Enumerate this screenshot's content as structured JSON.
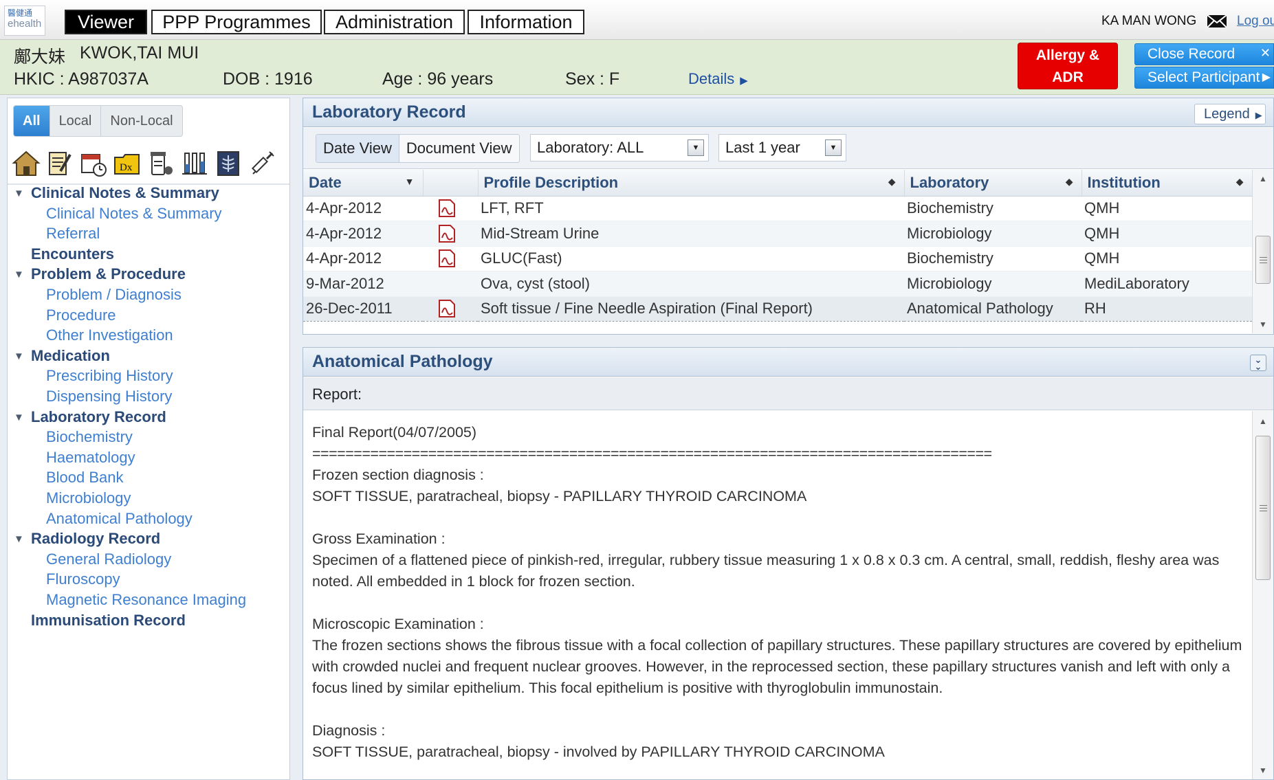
{
  "logo": {
    "line1": "醫健通",
    "line2": "ehealth"
  },
  "nav": {
    "tabs": [
      {
        "label": "Viewer",
        "active": true
      },
      {
        "label": "PPP Programmes",
        "active": false
      },
      {
        "label": "Administration",
        "active": false
      },
      {
        "label": "Information",
        "active": false
      }
    ],
    "user": "KA MAN WONG",
    "logout": "Log out"
  },
  "patient": {
    "chinese_name": "鄺大妹",
    "english_name": "KWOK,TAI MUI",
    "hkic": "HKIC : A987037A",
    "dob": "DOB : 1916",
    "age": "Age : 96 years",
    "sex": "Sex : F",
    "details_link": "Details"
  },
  "actions": {
    "allergy_line1": "Allergy &",
    "allergy_line2": "ADR",
    "close_record": "Close Record",
    "select_participant": "Select Participant"
  },
  "sidebar": {
    "scope": [
      {
        "label": "All",
        "active": true
      },
      {
        "label": "Local",
        "active": false
      },
      {
        "label": "Non-Local",
        "active": false
      }
    ],
    "tools": [
      "home-icon",
      "notes-icon",
      "calendar-icon",
      "diagnosis-icon",
      "medication-icon",
      "lab-tubes-icon",
      "radiology-icon",
      "syringe-icon"
    ],
    "tree": [
      {
        "label": "Clinical Notes & Summary",
        "type": "head",
        "expanded": true
      },
      {
        "label": "Clinical Notes & Summary",
        "type": "child"
      },
      {
        "label": "Referral",
        "type": "child"
      },
      {
        "label": "Encounters",
        "type": "head",
        "expanded": null
      },
      {
        "label": "Problem & Procedure",
        "type": "head",
        "expanded": true
      },
      {
        "label": "Problem / Diagnosis",
        "type": "child"
      },
      {
        "label": "Procedure",
        "type": "child"
      },
      {
        "label": "Other Investigation",
        "type": "child"
      },
      {
        "label": "Medication",
        "type": "head",
        "expanded": true
      },
      {
        "label": "Prescribing History",
        "type": "child"
      },
      {
        "label": "Dispensing History",
        "type": "child"
      },
      {
        "label": "Laboratory Record",
        "type": "head",
        "expanded": true
      },
      {
        "label": "Biochemistry",
        "type": "child"
      },
      {
        "label": "Haematology",
        "type": "child"
      },
      {
        "label": "Blood Bank",
        "type": "child"
      },
      {
        "label": "Microbiology",
        "type": "child"
      },
      {
        "label": "Anatomical Pathology",
        "type": "child"
      },
      {
        "label": "Radiology Record",
        "type": "head",
        "expanded": true
      },
      {
        "label": "General Radiology",
        "type": "child"
      },
      {
        "label": "Fluroscopy",
        "type": "child"
      },
      {
        "label": "Magnetic Resonance Imaging",
        "type": "child"
      },
      {
        "label": "Immunisation Record",
        "type": "head",
        "expanded": null
      }
    ]
  },
  "lab": {
    "title": "Laboratory Record",
    "legend": "Legend",
    "views": [
      {
        "label": "Date View",
        "active": true
      },
      {
        "label": "Document View",
        "active": false
      }
    ],
    "lab_filter": "Laboratory: ALL",
    "period_filter": "Last 1 year",
    "columns": [
      "Date",
      "",
      "Profile Description",
      "Laboratory",
      "Institution"
    ],
    "rows": [
      {
        "date": "4-Apr-2012",
        "pdf": true,
        "desc": "LFT, RFT",
        "lab": "Biochemistry",
        "inst": "QMH"
      },
      {
        "date": "4-Apr-2012",
        "pdf": true,
        "desc": "Mid-Stream Urine",
        "lab": "Microbiology",
        "inst": "QMH"
      },
      {
        "date": "4-Apr-2012",
        "pdf": true,
        "desc": "GLUC(Fast)",
        "lab": "Biochemistry",
        "inst": "QMH"
      },
      {
        "date": "9-Mar-2012",
        "pdf": false,
        "desc": "Ova, cyst (stool)",
        "lab": "Microbiology",
        "inst": "MediLaboratory"
      },
      {
        "date": "26-Dec-2011",
        "pdf": true,
        "desc": "Soft tissue / Fine Needle Aspiration (Final Report)",
        "lab": "Anatomical Pathology",
        "inst": "RH"
      }
    ]
  },
  "ap": {
    "title": "Anatomical Pathology",
    "report_label": "Report:",
    "lines": [
      "Final Report(04/07/2005)",
      "==================================================================================",
      "Frozen section diagnosis :",
      "SOFT TISSUE, paratracheal, biopsy - PAPILLARY THYROID CARCINOMA",
      "",
      "Gross Examination :",
      "Specimen of a flattened piece of pinkish-red, irregular, rubbery tissue measuring 1 x 0.8 x 0.3 cm. A central, small, reddish, fleshy area was noted. All embedded in 1 block for frozen section.",
      "",
      "Microscopic Examination :",
      "The frozen sections shows the fibrous tissue with a focal collection of papillary structures. These papillary structures are covered by epithelium with crowded nuclei and frequent nuclear grooves. However, in the reprocessed section, these papillary structures vanish and left with only a focus lined by similar epithelium. This focal epithelium is positive with thyroglobulin immunostain.",
      "",
      "Diagnosis :",
      "SOFT TISSUE, paratracheal, biopsy - involved by PAPILLARY THYROID CARCINOMA"
    ]
  }
}
